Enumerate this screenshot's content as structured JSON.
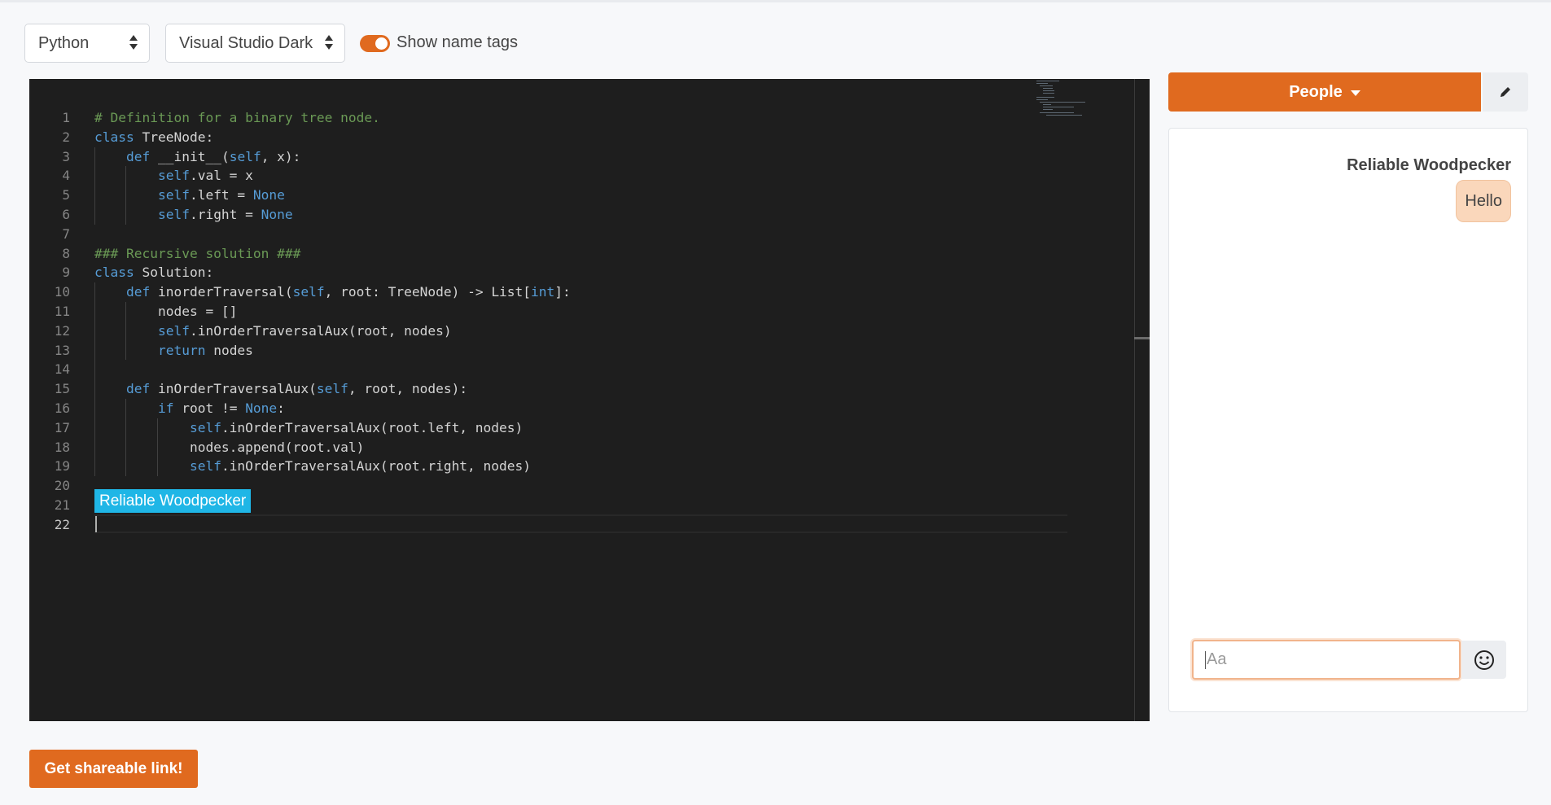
{
  "toolbar": {
    "language": "Python",
    "theme": "Visual Studio Dark",
    "show_name_tags_label": "Show name tags",
    "show_name_tags_on": true
  },
  "editor": {
    "line_numbers": [
      "1",
      "2",
      "3",
      "4",
      "5",
      "6",
      "7",
      "8",
      "9",
      "10",
      "11",
      "12",
      "13",
      "14",
      "15",
      "16",
      "17",
      "18",
      "19",
      "20",
      "21",
      "22"
    ],
    "name_tag": "Reliable Woodpecker"
  },
  "share_button": "Get shareable link!",
  "people_button": "People",
  "chat": {
    "messages": [
      {
        "author": "Reliable Woodpecker",
        "text": "Hello"
      }
    ],
    "input_placeholder": "Aa"
  },
  "colors": {
    "accent": "#e06a1f",
    "name_tag": "#1fb6e6",
    "editor_bg": "#1e1e1e"
  }
}
